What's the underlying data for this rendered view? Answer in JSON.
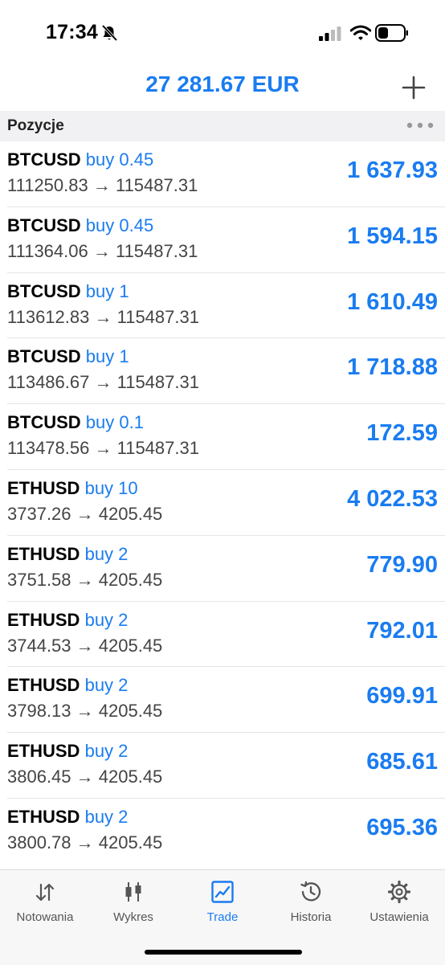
{
  "status_bar": {
    "time": "17:34"
  },
  "header": {
    "balance": "27 281.67 EUR"
  },
  "section": {
    "title": "Pozycje"
  },
  "positions": [
    {
      "symbol": "BTCUSD",
      "side": "buy 0.45",
      "open": "111250.83",
      "current": "115487.31",
      "profit": "1 637.93"
    },
    {
      "symbol": "BTCUSD",
      "side": "buy 0.45",
      "open": "111364.06",
      "current": "115487.31",
      "profit": "1 594.15"
    },
    {
      "symbol": "BTCUSD",
      "side": "buy 1",
      "open": "113612.83",
      "current": "115487.31",
      "profit": "1 610.49"
    },
    {
      "symbol": "BTCUSD",
      "side": "buy 1",
      "open": "113486.67",
      "current": "115487.31",
      "profit": "1 718.88"
    },
    {
      "symbol": "BTCUSD",
      "side": "buy 0.1",
      "open": "113478.56",
      "current": "115487.31",
      "profit": "172.59"
    },
    {
      "symbol": "ETHUSD",
      "side": "buy 10",
      "open": "3737.26",
      "current": "4205.45",
      "profit": "4 022.53"
    },
    {
      "symbol": "ETHUSD",
      "side": "buy 2",
      "open": "3751.58",
      "current": "4205.45",
      "profit": "779.90"
    },
    {
      "symbol": "ETHUSD",
      "side": "buy 2",
      "open": "3744.53",
      "current": "4205.45",
      "profit": "792.01"
    },
    {
      "symbol": "ETHUSD",
      "side": "buy 2",
      "open": "3798.13",
      "current": "4205.45",
      "profit": "699.91"
    },
    {
      "symbol": "ETHUSD",
      "side": "buy 2",
      "open": "3806.45",
      "current": "4205.45",
      "profit": "685.61"
    },
    {
      "symbol": "ETHUSD",
      "side": "buy 2",
      "open": "3800.78",
      "current": "4205.45",
      "profit": "695.36"
    }
  ],
  "tabbar": {
    "tabs": [
      {
        "label": "Notowania",
        "icon": "quotes-arrows-icon"
      },
      {
        "label": "Wykres",
        "icon": "candlestick-icon"
      },
      {
        "label": "Trade",
        "icon": "trade-chart-icon",
        "active": true
      },
      {
        "label": "Historia",
        "icon": "history-clock-icon"
      },
      {
        "label": "Ustawienia",
        "icon": "gear-icon"
      }
    ]
  },
  "colors": {
    "accent": "#1a7cf0",
    "section_bg": "#f1f1f3",
    "tabbar_bg": "#f7f7f8"
  }
}
